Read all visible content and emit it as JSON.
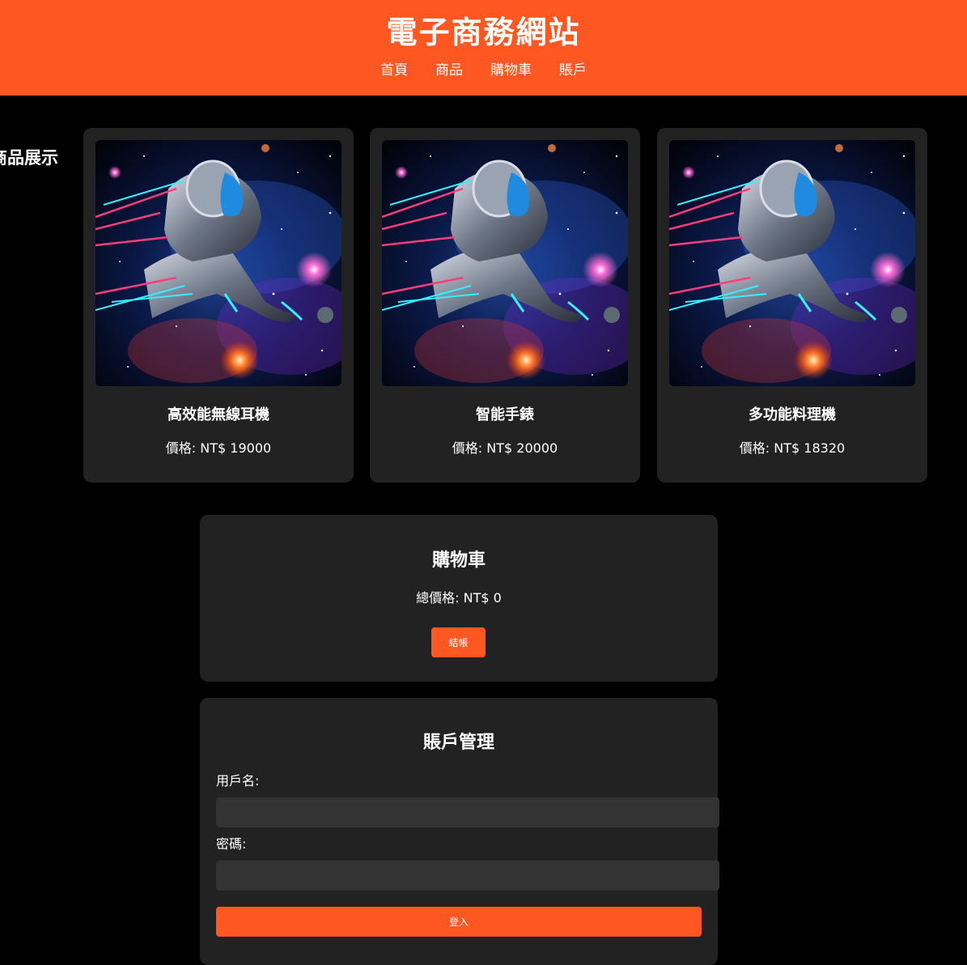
{
  "header": {
    "title": "電子商務網站",
    "nav": [
      "首頁",
      "商品",
      "購物車",
      "賬戶"
    ]
  },
  "products": {
    "section_title": "商品展示",
    "items": [
      {
        "name": "高效能無線耳機",
        "price": "價格: NT$ 19000"
      },
      {
        "name": "智能手錶",
        "price": "價格: NT$ 20000"
      },
      {
        "name": "多功能料理機",
        "price": "價格: NT$ 18320"
      }
    ]
  },
  "cart": {
    "title": "購物車",
    "total": "總價格: NT$ 0",
    "checkout_label": "結帳"
  },
  "account": {
    "title": "賬戶管理",
    "username_label": "用戶名:",
    "password_label": "密碼:",
    "username_value": "",
    "password_value": "",
    "login_label": "登入"
  },
  "colors": {
    "accent": "#ff5722",
    "background": "#000000",
    "card": "#222222",
    "input": "#333333"
  }
}
